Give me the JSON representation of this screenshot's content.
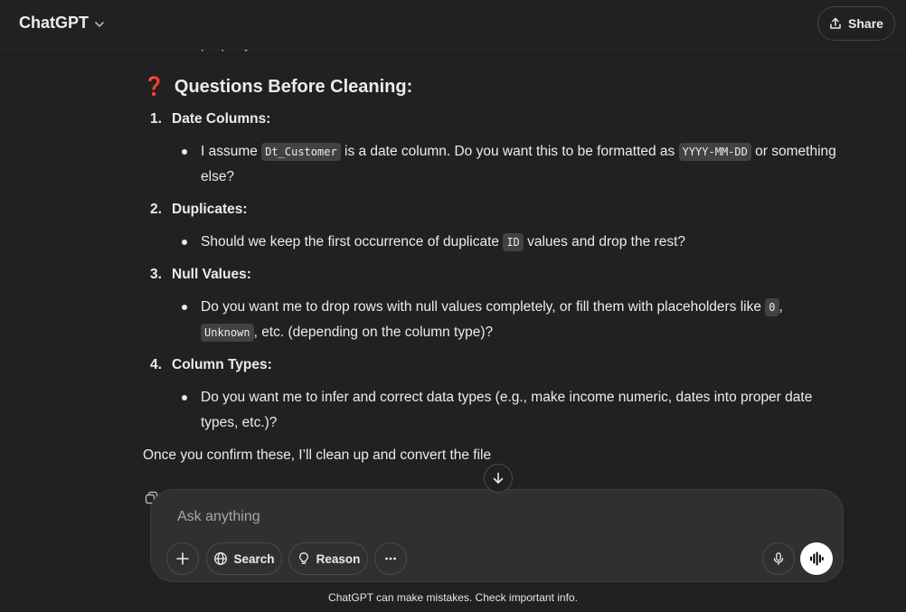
{
  "header": {
    "title": "ChatGPT",
    "share_label": "Share"
  },
  "message": {
    "partial_line": "properly",
    "heading": "Questions Before Cleaning:",
    "heading_emoji": "❓",
    "questions": [
      {
        "number": "1.",
        "title": "Date Columns:",
        "bullet": {
          "t1": "I assume ",
          "c1": "Dt_Customer",
          "t2": " is a date column. Do you want this to be formatted as ",
          "c2": "YYYY-MM-DD",
          "t3": " or something else?"
        }
      },
      {
        "number": "2.",
        "title": "Duplicates:",
        "bullet": {
          "t1": "Should we keep the first occurrence of duplicate ",
          "c1": "ID",
          "t2": " values and drop the rest?"
        }
      },
      {
        "number": "3.",
        "title": "Null Values:",
        "bullet": {
          "t1": "Do you want me to drop rows with null values completely, or fill them with placeholders like ",
          "c1": "0",
          "t2": ", ",
          "c2": "Unknown",
          "t3": ", etc. (depending on the column type)?"
        }
      },
      {
        "number": "4.",
        "title": "Column Types:",
        "bullet": {
          "t1": "Do you want me to infer and correct data types (e.g., make income numeric, dates into proper date types, etc.)?"
        }
      }
    ],
    "closing": "Once you confirm these, I’ll clean up and convert the file"
  },
  "composer": {
    "placeholder": "Ask anything",
    "search_label": "Search",
    "reason_label": "Reason"
  },
  "footer": {
    "disclaimer": "ChatGPT can make mistakes. Check important info."
  },
  "icons": {
    "title_dropdown": "chevron-down-icon",
    "share": "share-icon",
    "scroll": "arrow-down-icon",
    "copy": "copy-icon",
    "plus": "plus-icon",
    "search": "globe-icon",
    "reason": "lightbulb-icon",
    "more": "ellipsis-icon",
    "mic": "microphone-icon",
    "voice": "voice-wave-icon"
  },
  "colors": {
    "background": "#212121",
    "composer_bg": "#303030",
    "text": "#ececec",
    "question_mark": "#e0303a"
  }
}
